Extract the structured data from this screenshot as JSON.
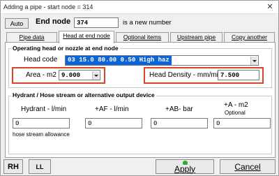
{
  "window": {
    "title": "Adding a pipe - start node = 314",
    "close_glyph": "✕"
  },
  "top": {
    "auto_label": "Auto",
    "end_node_label": "End node",
    "end_node_value": "374",
    "new_number_text": "is a new number"
  },
  "tabs": [
    {
      "label": "Pipe data"
    },
    {
      "label": "Head at end node"
    },
    {
      "label": "Optional items"
    },
    {
      "label": "Upstream pipe"
    },
    {
      "label": "Copy another"
    }
  ],
  "operating": {
    "title": "Operating head or nozzle at end node",
    "head_code_label": "Head code",
    "head_code_value": "03 15.0  80.00   0.50 High haz",
    "area_label": "Area - m2",
    "area_value": "9.000",
    "head_density_label": "Head Density - mm/min",
    "head_density_value": "7.500"
  },
  "hydrant": {
    "title": "Hydrant / Hose stream or alternative output device",
    "hydrant_label": "Hydrant - l/min",
    "hydrant_value": "0",
    "hose_allowance": "hose stream allowance",
    "af_label": "+AF - l/min",
    "af_value": "0",
    "ab_label": "+AB- bar",
    "ab_value": "0",
    "a_label": "+A - m2",
    "a_optional": "Optional",
    "a_value": "0"
  },
  "bottom": {
    "rh_label": "RH",
    "ll_label": "LL",
    "apply_label": "Apply",
    "cancel_label": "Cancel"
  },
  "colors": {
    "highlight": "#d9442b",
    "selected_text_bg": "#0a64d8",
    "apply_icon": "#3aa336"
  }
}
